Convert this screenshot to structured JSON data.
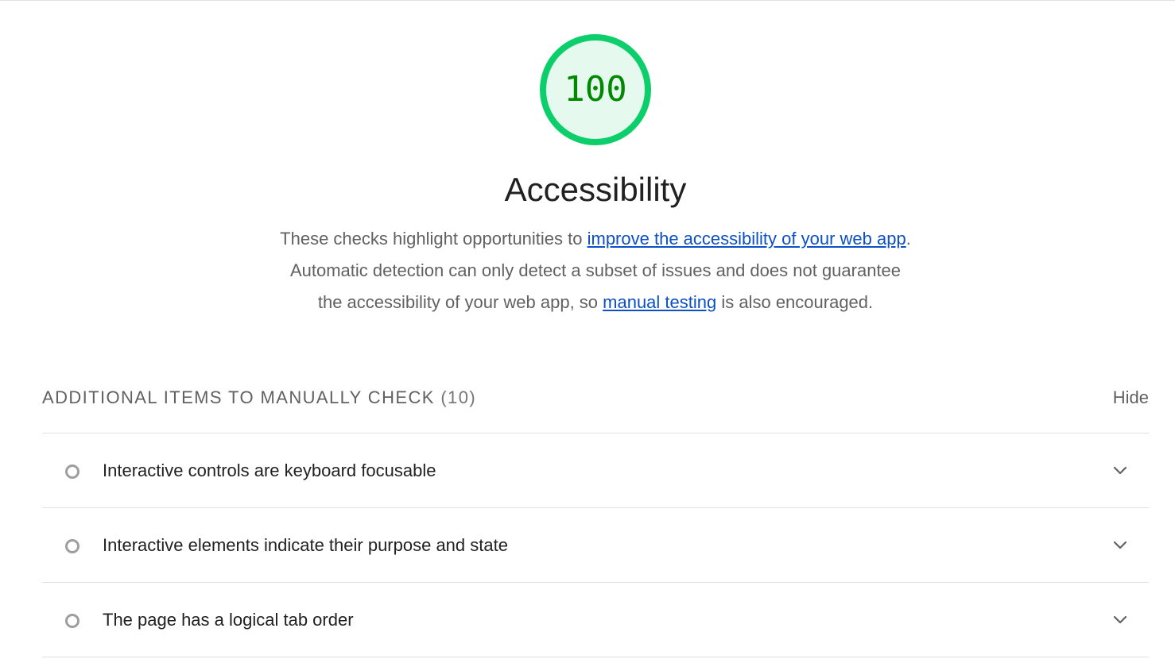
{
  "score": {
    "value": "100",
    "fraction": 1.0,
    "ring_color": "#0cce6b",
    "fill_color": "#e6f9ee",
    "text_color": "#008800"
  },
  "category": {
    "title": "Accessibility"
  },
  "description": {
    "part1": "These checks highlight opportunities to ",
    "link1": "improve the accessibility of your web app",
    "part2": ". Automatic detection can only detect a subset of issues and does not guarantee the accessibility of your web app, so ",
    "link2": "manual testing",
    "part3": " is also encouraged.",
    "link_color": "#0c50c7"
  },
  "group": {
    "title": "Additional items to manually check",
    "count": "(10)",
    "toggle_label": "Hide"
  },
  "audits": [
    {
      "label": "Interactive controls are keyboard focusable",
      "icon": "manual-check-circle-icon"
    },
    {
      "label": "Interactive elements indicate their purpose and state",
      "icon": "manual-check-circle-icon"
    },
    {
      "label": "The page has a logical tab order",
      "icon": "manual-check-circle-icon"
    }
  ]
}
